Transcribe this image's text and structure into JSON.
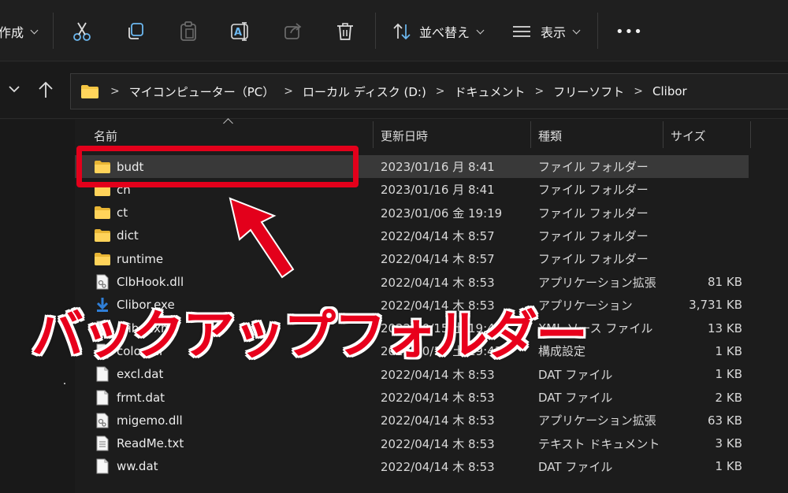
{
  "toolbar": {
    "new_label": "作成",
    "sort_label": "並べ替え",
    "view_label": "表示",
    "more_label": "•••"
  },
  "address": {
    "crumbs": [
      "マイコンピューター（PC）",
      "ローカル ディスク (D:)",
      "ドキュメント",
      "フリーソフト",
      "Clibor"
    ]
  },
  "columns": {
    "name": "名前",
    "date": "更新日時",
    "type": "種類",
    "size": "サイズ"
  },
  "files": [
    {
      "name": "budt",
      "date": "2023/01/16 月 8:41",
      "type": "ファイル フォルダー",
      "size": "",
      "icon": "folder-icon"
    },
    {
      "name": "ch",
      "date": "2023/01/16 月 8:41",
      "type": "ファイル フォルダー",
      "size": "",
      "icon": "folder-icon"
    },
    {
      "name": "ct",
      "date": "2023/01/06 金 19:19",
      "type": "ファイル フォルダー",
      "size": "",
      "icon": "folder-icon"
    },
    {
      "name": "dict",
      "date": "2022/04/14 木 8:57",
      "type": "ファイル フォルダー",
      "size": "",
      "icon": "folder-icon"
    },
    {
      "name": "runtime",
      "date": "2022/04/14 木 8:57",
      "type": "ファイル フォルダー",
      "size": "",
      "icon": "folder-icon"
    },
    {
      "name": "ClbHook.dll",
      "date": "2022/04/14 木 8:53",
      "type": "アプリケーション拡張",
      "size": "81 KB",
      "icon": "dll-icon"
    },
    {
      "name": "Clibor.exe",
      "date": "2022/04/14 木 8:53",
      "type": "アプリケーション",
      "size": "3,731 KB",
      "icon": "exe-icon"
    },
    {
      "name": "Clibor.xml",
      "date": "2022/10/15 土 19:49",
      "type": "XML ソース ファイル",
      "size": "13 KB",
      "icon": "xml-icon"
    },
    {
      "name": "color.ini",
      "date": "2022/10/15 土 19:43",
      "type": "構成設定",
      "size": "1 KB",
      "icon": "ini-icon"
    },
    {
      "name": "excl.dat",
      "date": "2022/04/14 木 8:53",
      "type": "DAT ファイル",
      "size": "1 KB",
      "icon": "file-icon"
    },
    {
      "name": "frmt.dat",
      "date": "2022/04/14 木 8:53",
      "type": "DAT ファイル",
      "size": "2 KB",
      "icon": "file-icon"
    },
    {
      "name": "migemo.dll",
      "date": "2022/04/14 木 8:53",
      "type": "アプリケーション拡張",
      "size": "63 KB",
      "icon": "dll-icon"
    },
    {
      "name": "ReadMe.txt",
      "date": "2022/04/14 木 8:53",
      "type": "テキスト ドキュメント",
      "size": "3 KB",
      "icon": "text-file-icon"
    },
    {
      "name": "ww.dat",
      "date": "2022/04/14 木 8:53",
      "type": "DAT ファイル",
      "size": "1 KB",
      "icon": "file-icon"
    }
  ],
  "annotation": {
    "caption": "バックアップフォルダー",
    "color": "#e3001b"
  }
}
